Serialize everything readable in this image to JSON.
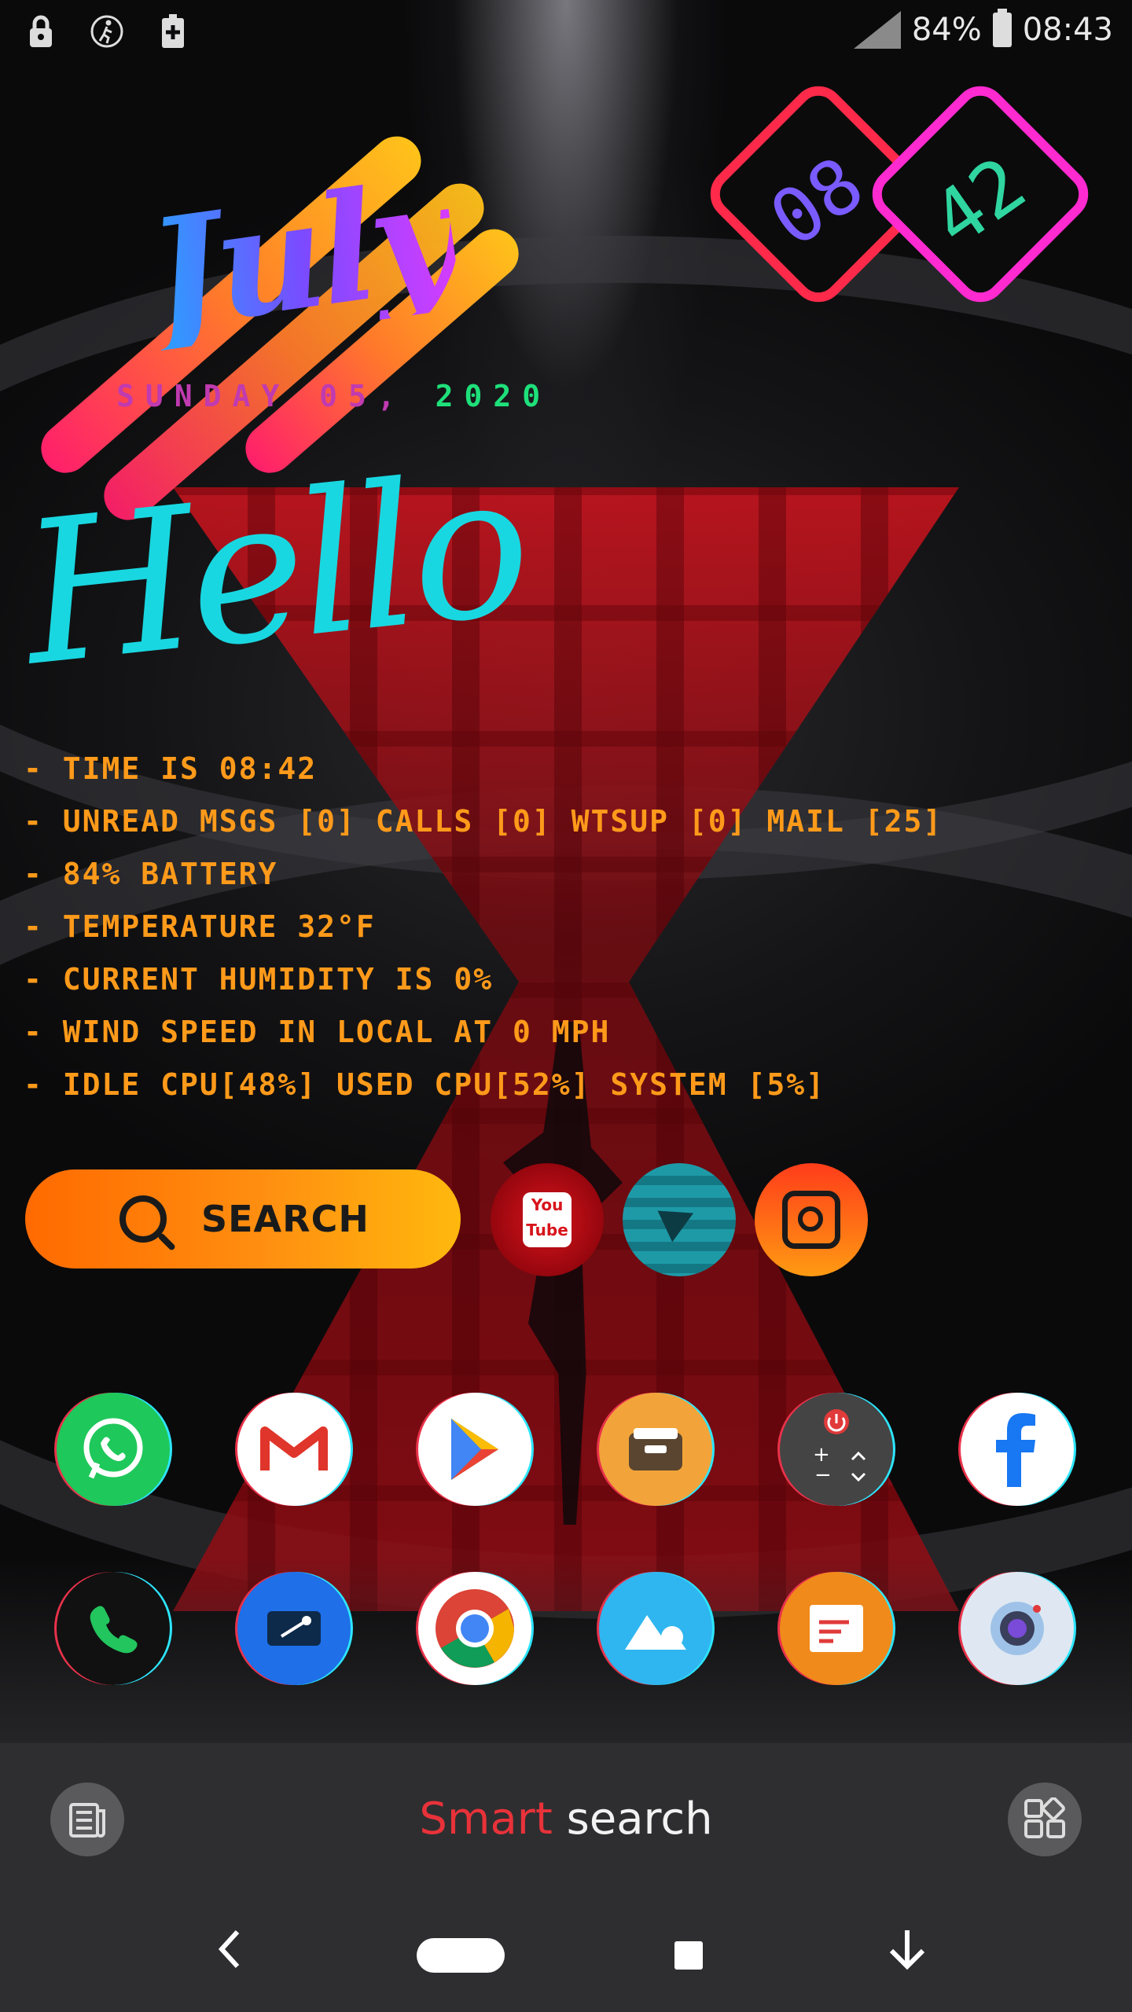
{
  "status_bar": {
    "left_icons": [
      "lock-icon",
      "walk-icon",
      "battery-saver-icon"
    ],
    "battery_percent": "84%",
    "time": "08:43"
  },
  "widget": {
    "month": "July",
    "date_part1": "SUNDAY 05,",
    "date_part2": "2020",
    "clock_hours": "08",
    "clock_minutes": "42",
    "greeting": "Hello"
  },
  "info_lines": [
    "- TIME IS 08:42",
    "- UNREAD MSGS [0] CALLS [0] WTSUP [0] MAIL [25]",
    "- 84% BATTERY",
    "- TEMPERATURE 32°F",
    "- CURRENT HUMIDITY IS 0%",
    "- WIND SPEED IN LOCAL AT 0 MPH",
    "- IDLE CPU[48%] USED CPU[52%] SYSTEM [5%]"
  ],
  "search": {
    "label": "SEARCH"
  },
  "social": [
    {
      "name": "youtube",
      "text": "You Tube"
    },
    {
      "name": "telegram"
    },
    {
      "name": "instagram"
    }
  ],
  "apps_row1": [
    "whatsapp-icon",
    "gmail-icon",
    "play-store-icon",
    "file-manager-icon",
    "remote-control-icon",
    "facebook-icon"
  ],
  "apps_row2": [
    "phone-icon",
    "screen-recorder-icon",
    "chrome-icon",
    "gallery-icon",
    "slides-icon",
    "camera-icon"
  ],
  "dock": {
    "smart_word": "Smart",
    "search_word": "search"
  },
  "colors": {
    "accent_orange": "#ff9a1a",
    "hello_cyan": "#19d7e0",
    "smart_red": "#e8323a"
  }
}
